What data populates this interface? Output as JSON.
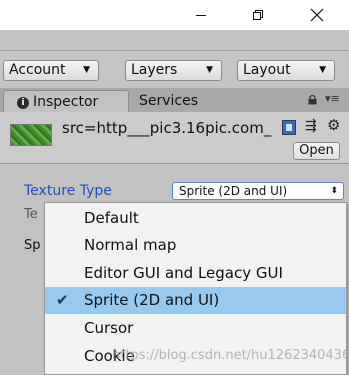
{
  "window_controls": {
    "minimize_icon": "minimize-icon",
    "maximize_icon": "maximize-icon",
    "close_icon": "close-icon"
  },
  "toolbar": {
    "account_label": "Account",
    "layers_label": "Layers",
    "layout_label": "Layout"
  },
  "tabs": {
    "inspector_label": "Inspector",
    "services_label": "Services"
  },
  "asset": {
    "name": "src=http___pic3.16pic.com_",
    "open_label": "Open"
  },
  "importer": {
    "texture_type_label": "Texture Type",
    "texture_type_value": "Sprite (2D and UI)",
    "row2_label_partial": "Te",
    "row3_label_partial": "Sp"
  },
  "dropdown": {
    "options": [
      "Default",
      "Normal map",
      "Editor GUI and Legacy GUI",
      "Sprite (2D and UI)",
      "Cursor",
      "Cookie"
    ],
    "selected": "Sprite (2D and UI)"
  },
  "watermark": "https://blog.csdn.net/hu1262340436",
  "colors": {
    "selection": "#99c9ef",
    "label_blue": "#1f4fc2",
    "panel_gray": "#c2c2c2"
  }
}
